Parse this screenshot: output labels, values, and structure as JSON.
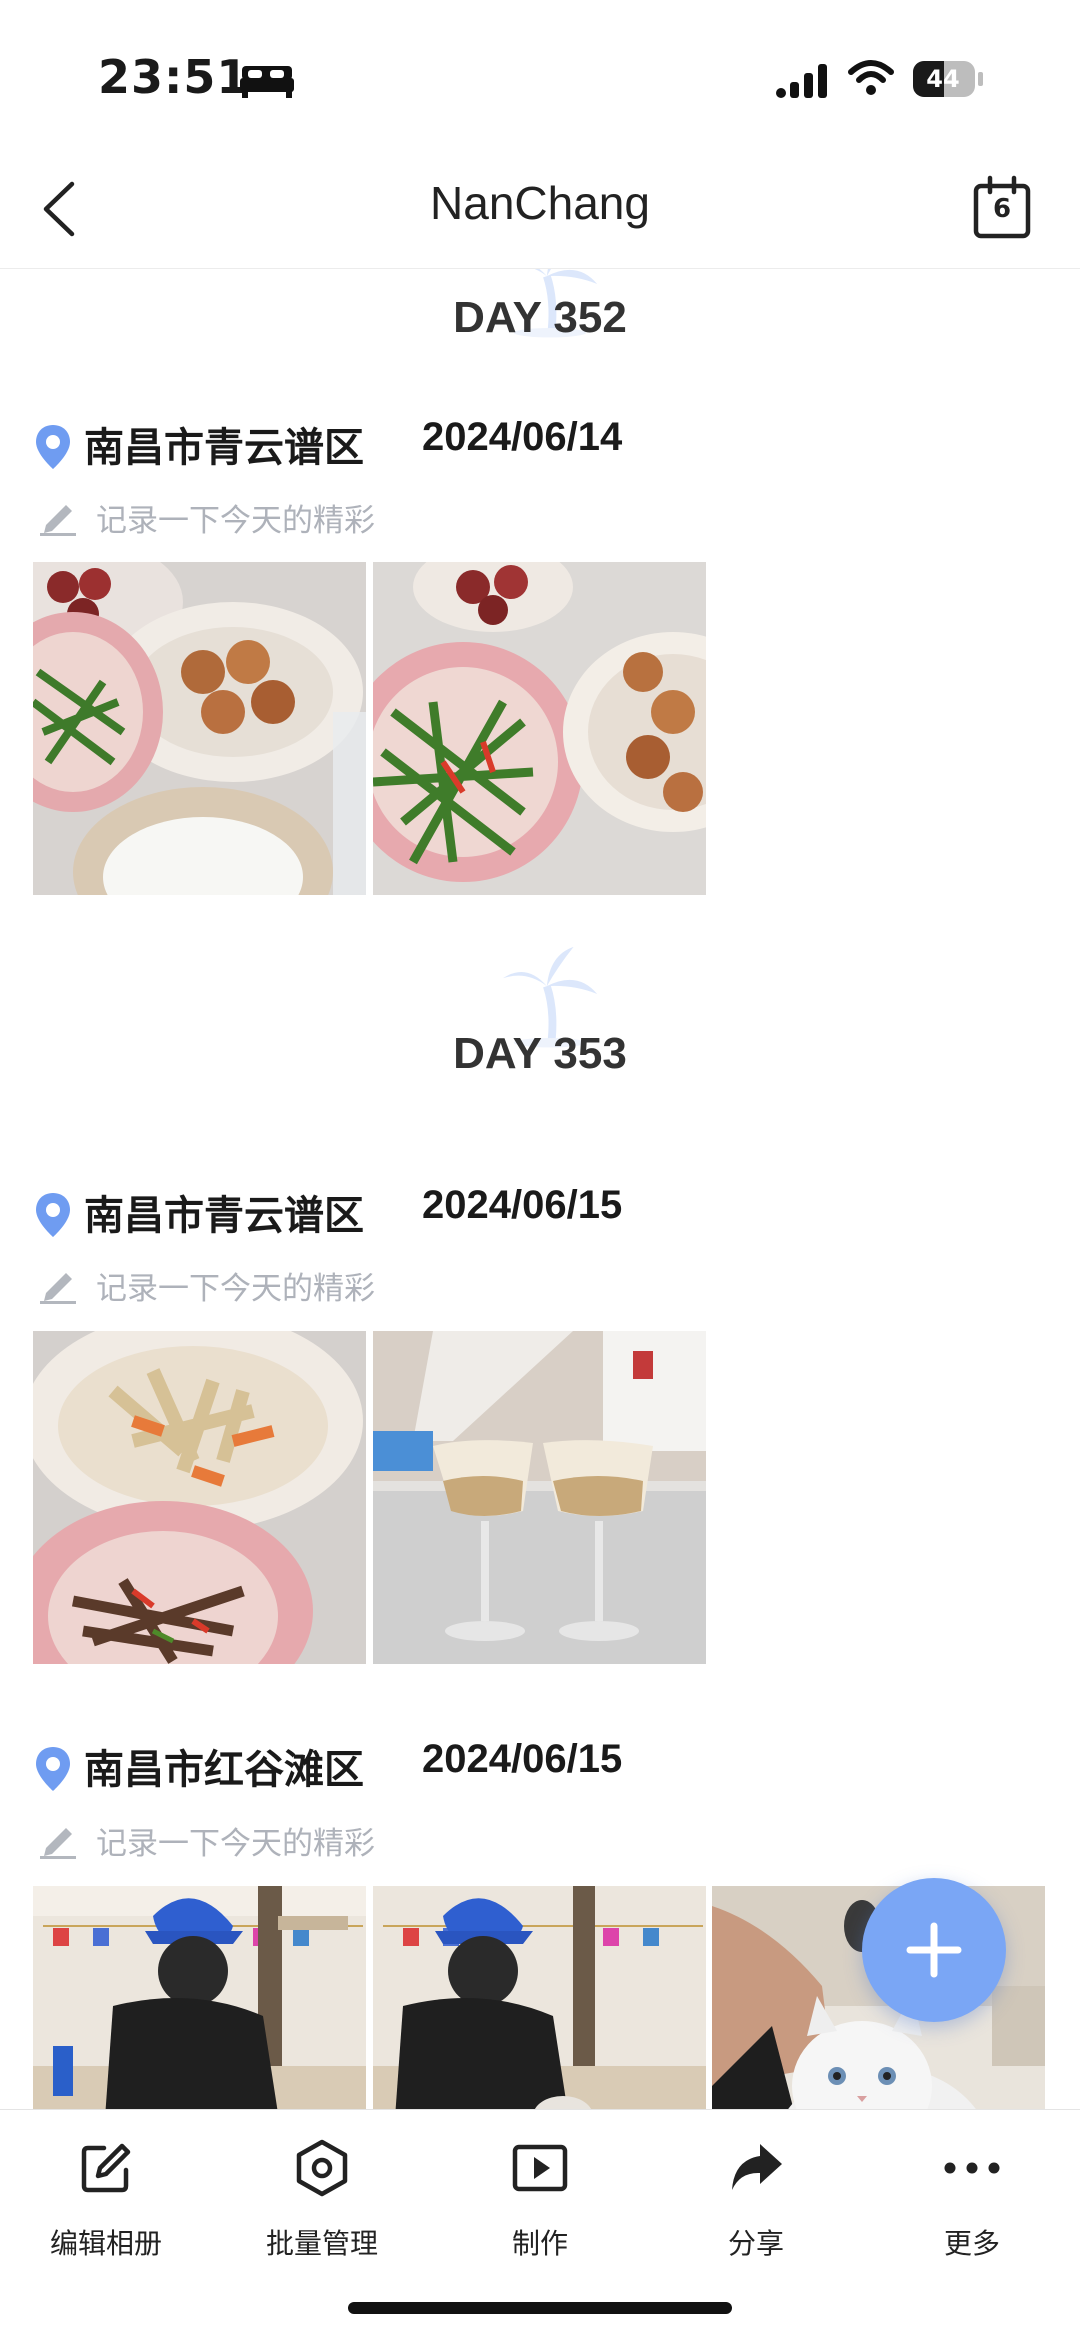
{
  "status_bar": {
    "time": "23:51",
    "battery": "44"
  },
  "nav": {
    "title": "NanChang",
    "calendar_day": "6"
  },
  "days": [
    {
      "day_label": "DAY 352",
      "entries": [
        {
          "location": "南昌市青云谱区",
          "date": "2024/06/14",
          "note_placeholder": "记录一下今天的精彩"
        }
      ]
    },
    {
      "day_label": "DAY 353",
      "entries": [
        {
          "location": "南昌市青云谱区",
          "date": "2024/06/15",
          "note_placeholder": "记录一下今天的精彩"
        },
        {
          "location": "南昌市红谷滩区",
          "date": "2024/06/15",
          "note_placeholder": "记录一下今天的精彩"
        }
      ]
    }
  ],
  "toolbar": {
    "items": [
      {
        "label": "编辑相册",
        "icon": "edit-icon"
      },
      {
        "label": "批量管理",
        "icon": "hexagon-icon"
      },
      {
        "label": "制作",
        "icon": "play-icon"
      },
      {
        "label": "分享",
        "icon": "share-icon"
      },
      {
        "label": "更多",
        "icon": "more-icon"
      }
    ]
  },
  "colors": {
    "accent": "#7aa6f5",
    "pin": "#6f9cf1",
    "placeholder": "#aeb2ba"
  }
}
